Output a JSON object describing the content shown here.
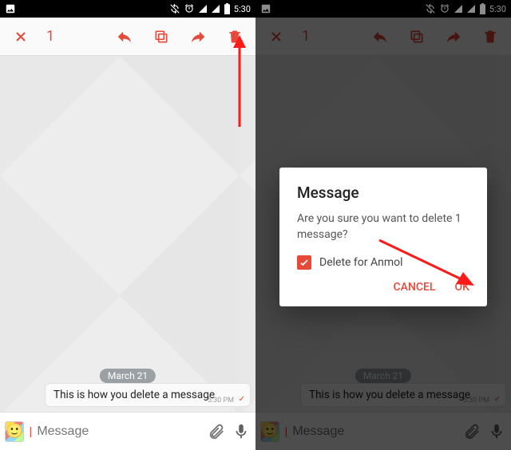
{
  "status": {
    "time": "5:30",
    "icons": [
      "picture-icon",
      "sync-off-icon",
      "alarm-icon",
      "signal-icon",
      "signal-icon",
      "battery-icon"
    ]
  },
  "actionbar": {
    "selected_count": "1"
  },
  "chat": {
    "date_pill": "March 21",
    "message_text": "This is how you delete a message",
    "message_time": "5:30 PM"
  },
  "composer": {
    "placeholder": "Message"
  },
  "dialog": {
    "title": "Message",
    "body": "Are you sure you want to delete 1 message?",
    "checkbox_label": "Delete for Anmol",
    "cancel": "CANCEL",
    "ok": "OK"
  }
}
